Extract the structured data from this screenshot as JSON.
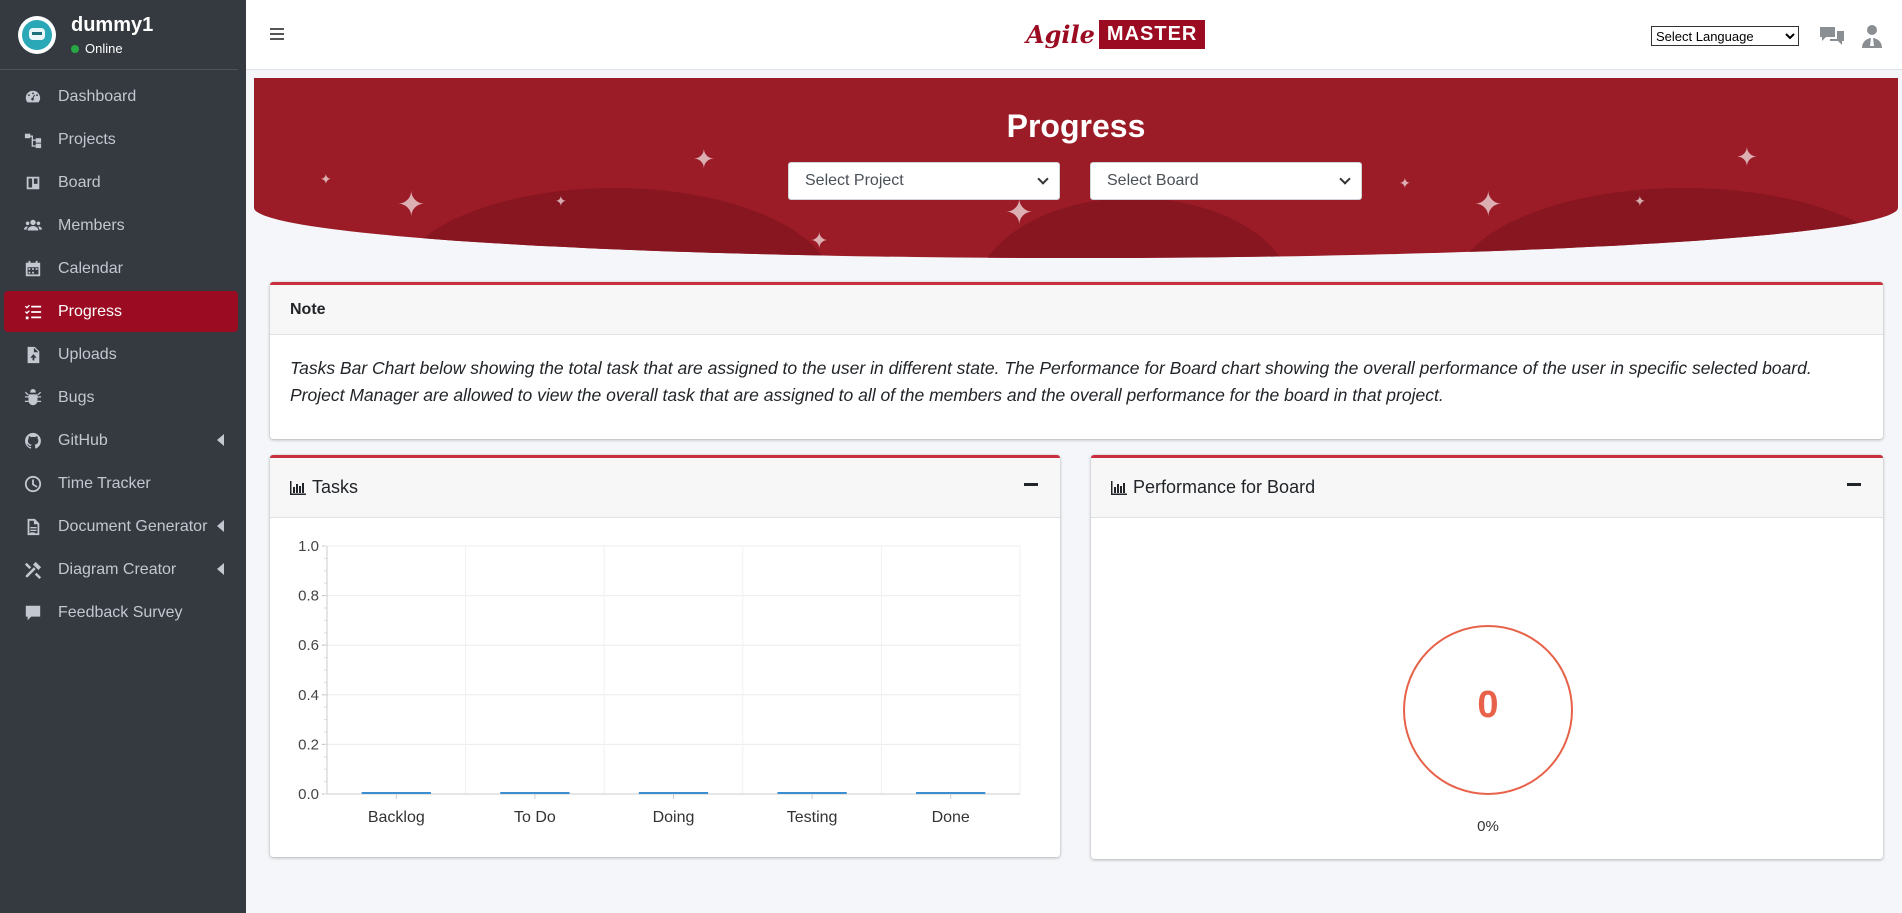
{
  "user": {
    "name": "dummy1",
    "status": "Online"
  },
  "sidebar": {
    "items": [
      {
        "label": "Dashboard",
        "icon": "dashboard-icon"
      },
      {
        "label": "Projects",
        "icon": "sitemap-icon"
      },
      {
        "label": "Board",
        "icon": "board-icon"
      },
      {
        "label": "Members",
        "icon": "users-icon"
      },
      {
        "label": "Calendar",
        "icon": "calendar-icon"
      },
      {
        "label": "Progress",
        "icon": "tasks-list-icon",
        "active": true
      },
      {
        "label": "Uploads",
        "icon": "file-upload-icon"
      },
      {
        "label": "Bugs",
        "icon": "bug-icon"
      },
      {
        "label": "GitHub",
        "icon": "github-icon"
      },
      {
        "label": "Time Tracker",
        "icon": "clock-icon"
      },
      {
        "label": "Document Generator",
        "icon": "document-icon"
      },
      {
        "label": "Diagram Creator",
        "icon": "tools-icon"
      },
      {
        "label": "Feedback Survey",
        "icon": "comment-icon"
      }
    ]
  },
  "topbar": {
    "logo_agile": "Agile",
    "logo_master": "MASTER",
    "language_select": "Select Language"
  },
  "banner": {
    "title": "Progress",
    "project_select": "Select Project",
    "board_select": "Select Board"
  },
  "note": {
    "title": "Note",
    "text": "Tasks Bar Chart below showing the total task that are assigned to the user in different state. The Performance for Board chart showing the overall performance of the user in specific selected board. Project Manager are allowed to view the overall task that are assigned to all of the members and the overall performance for the board in that project."
  },
  "tasks_card": {
    "title": "Tasks"
  },
  "performance_card": {
    "title": "Performance for Board",
    "value": "0",
    "percent": "0%"
  },
  "chart_data": {
    "type": "bar",
    "categories": [
      "Backlog",
      "To Do",
      "Doing",
      "Testing",
      "Done"
    ],
    "values": [
      0,
      0,
      0,
      0,
      0
    ],
    "ylim": [
      0,
      1.0
    ],
    "yticks": [
      "0.0",
      "0.2",
      "0.4",
      "0.6",
      "0.8",
      "1.0"
    ],
    "bar_color": "#3b8fd0",
    "grid": true
  },
  "colors": {
    "accent": "#9b0c22",
    "sidebar_bg": "#343a40",
    "card_border": "#c8303d",
    "gauge": "#e8624a"
  }
}
